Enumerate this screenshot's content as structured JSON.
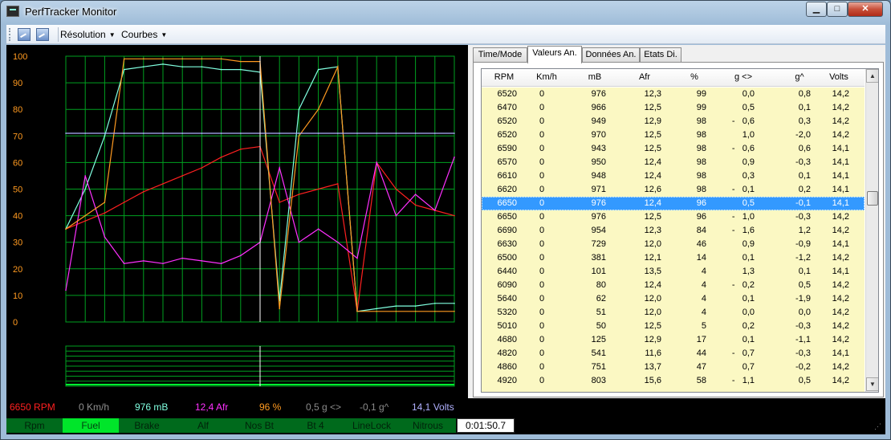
{
  "window": {
    "title": "PerfTracker Monitor",
    "min_glyph": "▁",
    "max_glyph": "□",
    "close_glyph": "✕"
  },
  "toolbar": {
    "icons": [
      "chart-image-icon",
      "chart-image-icon"
    ],
    "resolution_label": "Résolution",
    "curves_label": "Courbes"
  },
  "colors": {
    "rpm": "#ff2020",
    "speed": "#909090",
    "mb": "#80ffe0",
    "afr": "#ff30ff",
    "percent": "#ff9a20",
    "g_lat": "#8a8a8a",
    "g_long": "#8a8a8a",
    "volts": "#b0b0ff",
    "grid": "#00a020",
    "axis_text": "#ff9a20",
    "cursor": "#ffffff"
  },
  "chart": {
    "y_ticks": [
      "100",
      "90",
      "80",
      "70",
      "60",
      "50",
      "40",
      "30",
      "20",
      "10",
      "0"
    ]
  },
  "chart_data": {
    "type": "line",
    "title": "",
    "xlabel": "",
    "ylabel": "",
    "ylim": [
      0,
      100
    ],
    "grid": true,
    "x": [
      0,
      5,
      10,
      15,
      20,
      25,
      30,
      35,
      40,
      45,
      50,
      55,
      60,
      65,
      70,
      75,
      80,
      85,
      90,
      95,
      100
    ],
    "series": [
      {
        "name": "RPM",
        "color": "#ff2020",
        "values": [
          35,
          38,
          41,
          45,
          49,
          52,
          55,
          58,
          62,
          65,
          66,
          45,
          48,
          50,
          52,
          4,
          60,
          50,
          44,
          42,
          40
        ]
      },
      {
        "name": "mB",
        "color": "#80ffe0",
        "values": [
          35,
          50,
          70,
          95,
          96,
          97,
          96,
          96,
          95,
          95,
          94,
          8,
          80,
          95,
          96,
          4,
          5,
          6,
          6,
          7,
          7
        ]
      },
      {
        "name": "Afr",
        "color": "#ff30ff",
        "values": [
          12,
          55,
          32,
          22,
          23,
          22,
          24,
          23,
          22,
          25,
          30,
          58,
          30,
          35,
          30,
          24,
          60,
          40,
          48,
          42,
          62
        ]
      },
      {
        "name": "%",
        "color": "#ff9a20",
        "values": [
          35,
          40,
          45,
          99,
          99,
          99,
          99,
          99,
          99,
          98,
          98,
          5,
          70,
          80,
          96,
          4,
          4,
          4,
          4,
          4,
          4
        ]
      },
      {
        "name": "Volts",
        "color": "#b0b0ff",
        "values": [
          71,
          71,
          71,
          71,
          71,
          71,
          71,
          71,
          71,
          71,
          71,
          71,
          71,
          71,
          71,
          71,
          71,
          71,
          71,
          71,
          71
        ]
      }
    ]
  },
  "readouts": [
    {
      "key": "rpm",
      "text": "6650 RPM"
    },
    {
      "key": "speed",
      "text": "0 Km/h"
    },
    {
      "key": "mb",
      "text": "976 mB"
    },
    {
      "key": "afr",
      "text": "12,4 Afr"
    },
    {
      "key": "percent",
      "text": "96 %"
    },
    {
      "key": "g_lat",
      "text": "0,5 g <>"
    },
    {
      "key": "g_long",
      "text": "-0,1 g^"
    },
    {
      "key": "volts",
      "text": "14,1 Volts"
    }
  ],
  "status": {
    "items": [
      {
        "label": "Rpm",
        "active": false
      },
      {
        "label": "Fuel",
        "active": true
      },
      {
        "label": "Brake",
        "active": false
      },
      {
        "label": "Alf",
        "active": false
      },
      {
        "label": "Nos Bt",
        "active": false
      },
      {
        "label": "Bt 4",
        "active": false
      },
      {
        "label": "LineLock",
        "active": false
      },
      {
        "label": "Nitrous",
        "active": false
      }
    ],
    "time": "0:01:50.7"
  },
  "tabs": [
    {
      "label": "Time/Mode",
      "active": false
    },
    {
      "label": "Valeurs An.",
      "active": true
    },
    {
      "label": "Données An.",
      "active": false
    },
    {
      "label": "Etats Di.",
      "active": false
    }
  ],
  "table": {
    "columns": [
      "RPM",
      "Km/h",
      "mB",
      "Afr",
      "%",
      "g <>",
      "g^",
      "Volts"
    ],
    "selected_index": 8,
    "rows": [
      [
        "6520",
        "0",
        "976",
        "12,3",
        "99",
        "0,0",
        "0,8",
        "14,2"
      ],
      [
        "6470",
        "0",
        "966",
        "12,5",
        "99",
        "0,5",
        "0,1",
        "14,2"
      ],
      [
        "6520",
        "0",
        "949",
        "12,9",
        "98",
        "-   0,6",
        "0,3",
        "14,2"
      ],
      [
        "6520",
        "0",
        "970",
        "12,5",
        "98",
        "1,0",
        "-2,0",
        "14,2"
      ],
      [
        "6590",
        "0",
        "943",
        "12,5",
        "98",
        "-   0,6",
        "0,6",
        "14,1"
      ],
      [
        "6570",
        "0",
        "950",
        "12,4",
        "98",
        "0,9",
        "-0,3",
        "14,1"
      ],
      [
        "6610",
        "0",
        "948",
        "12,4",
        "98",
        "0,3",
        "0,1",
        "14,1"
      ],
      [
        "6620",
        "0",
        "971",
        "12,6",
        "98",
        "-   0,1",
        "0,2",
        "14,1"
      ],
      [
        "6650",
        "0",
        "976",
        "12,4",
        "96",
        "0,5",
        "-0,1",
        "14,1"
      ],
      [
        "6650",
        "0",
        "976",
        "12,5",
        "96",
        "-   1,0",
        "-0,3",
        "14,2"
      ],
      [
        "6690",
        "0",
        "954",
        "12,3",
        "84",
        "-   1,6",
        "1,2",
        "14,2"
      ],
      [
        "6630",
        "0",
        "729",
        "12,0",
        "46",
        "0,9",
        "-0,9",
        "14,1"
      ],
      [
        "6500",
        "0",
        "381",
        "12,1",
        "14",
        "0,1",
        "-1,2",
        "14,2"
      ],
      [
        "6440",
        "0",
        "101",
        "13,5",
        "4",
        "1,3",
        "0,1",
        "14,1"
      ],
      [
        "6090",
        "0",
        "80",
        "12,4",
        "4",
        "-   0,2",
        "0,5",
        "14,2"
      ],
      [
        "5640",
        "0",
        "62",
        "12,0",
        "4",
        "0,1",
        "-1,9",
        "14,2"
      ],
      [
        "5320",
        "0",
        "51",
        "12,0",
        "4",
        "0,0",
        "0,0",
        "14,2"
      ],
      [
        "5010",
        "0",
        "50",
        "12,5",
        "5",
        "0,2",
        "-0,3",
        "14,2"
      ],
      [
        "4680",
        "0",
        "125",
        "12,9",
        "17",
        "0,1",
        "-1,1",
        "14,2"
      ],
      [
        "4820",
        "0",
        "541",
        "11,6",
        "44",
        "-   0,7",
        "-0,3",
        "14,1"
      ],
      [
        "4860",
        "0",
        "751",
        "13,7",
        "47",
        "0,7",
        "-0,2",
        "14,2"
      ],
      [
        "4920",
        "0",
        "803",
        "15,6",
        "58",
        "-   1,1",
        "0,5",
        "14,2"
      ]
    ]
  }
}
